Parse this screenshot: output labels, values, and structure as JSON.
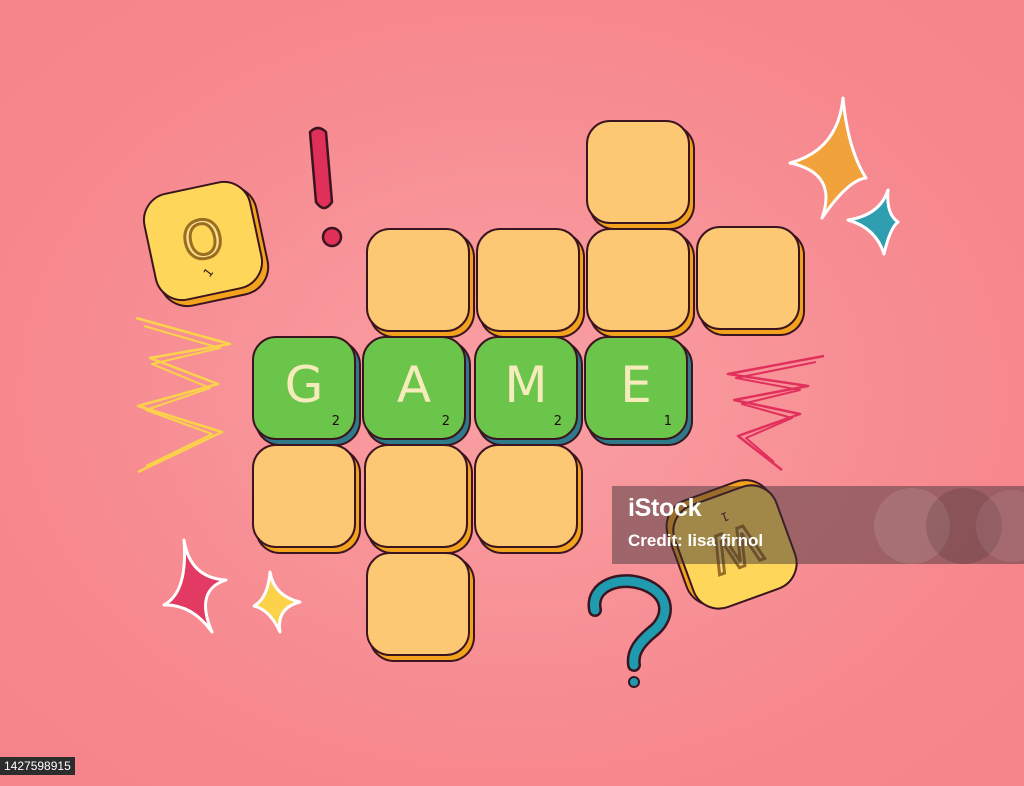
{
  "word_tiles": [
    {
      "letter": "G",
      "score": "2"
    },
    {
      "letter": "A",
      "score": "2"
    },
    {
      "letter": "M",
      "score": "2"
    },
    {
      "letter": "E",
      "score": "1"
    }
  ],
  "floating_tiles": [
    {
      "letter": "O",
      "score": "1"
    },
    {
      "letter": "W",
      "score": "1"
    }
  ],
  "watermark": {
    "logo": "iStock",
    "credit": "Credit: lisa firnol"
  },
  "stock_id": "1427598915",
  "colors": {
    "background": "#f6878d",
    "empty_tile": "#fdc874",
    "letter_tile": "#6cc54b",
    "tile_outline": "#3a1520",
    "tile_shadow": "#f2a21c",
    "floating_tile": "#fdd65a"
  },
  "icons": {
    "exclamation": "exclamation-icon",
    "question": "question-icon",
    "sparkle": "sparkle-icon",
    "zigzag": "zigzag-icon"
  }
}
